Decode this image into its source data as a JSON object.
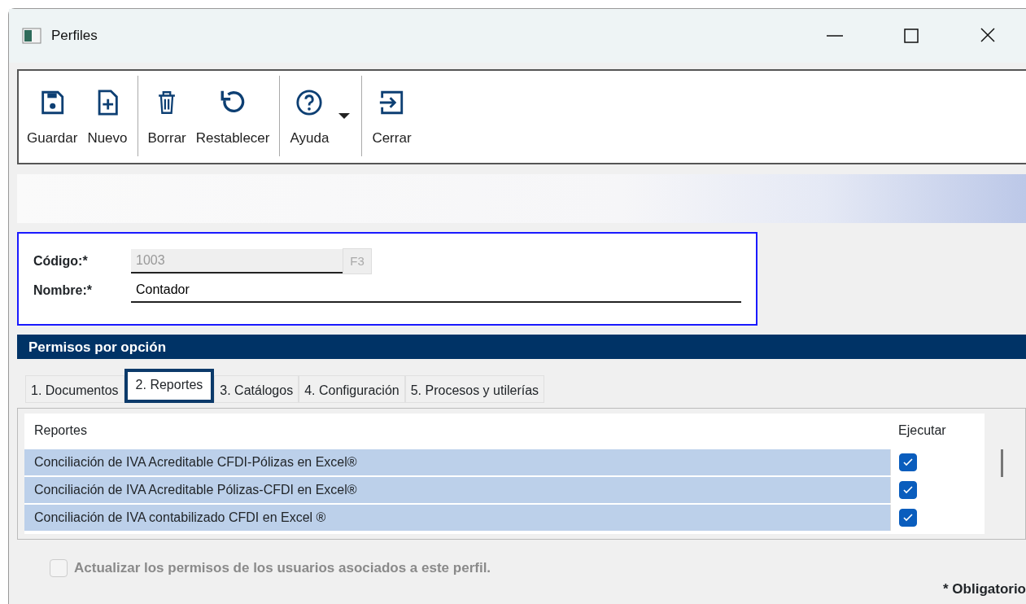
{
  "window": {
    "title": "Perfiles"
  },
  "toolbar": [
    {
      "kind": "save",
      "label": "Guardar",
      "group_end": false,
      "dropdown": false
    },
    {
      "kind": "new",
      "label": "Nuevo",
      "group_end": true,
      "dropdown": false
    },
    {
      "kind": "delete",
      "label": "Borrar",
      "group_end": false,
      "dropdown": false
    },
    {
      "kind": "reset",
      "label": "Restablecer",
      "group_end": true,
      "dropdown": false
    },
    {
      "kind": "help",
      "label": "Ayuda",
      "group_end": true,
      "dropdown": true
    },
    {
      "kind": "close",
      "label": "Cerrar",
      "group_end": false,
      "dropdown": false
    }
  ],
  "form": {
    "fields": [
      {
        "label": "Código:",
        "required_mark": "*",
        "value": "1003",
        "disabled": true,
        "button": "F3"
      },
      {
        "label": "Nombre:",
        "required_mark": "*",
        "value": "Contador",
        "disabled": false
      }
    ]
  },
  "section_title": "Permisos por opción",
  "tabs": [
    {
      "label": "1. Documentos",
      "selected": false
    },
    {
      "label": "2. Reportes",
      "selected": true
    },
    {
      "label": "3. Catálogos",
      "selected": false
    },
    {
      "label": "4. Configuración",
      "selected": false
    },
    {
      "label": "5. Procesos y utilerías",
      "selected": false
    }
  ],
  "table": {
    "columns": [
      "Reportes",
      "Ejecutar"
    ],
    "rows": [
      {
        "name": "Conciliación de IVA Acreditable CFDI-Pólizas en Excel®",
        "checked": true,
        "selected": true
      },
      {
        "name": "Conciliación de IVA Acreditable Pólizas-CFDI en Excel®",
        "checked": true,
        "selected": true
      },
      {
        "name": "Conciliación de IVA contabilizado CFDI en Excel ®",
        "checked": true,
        "selected": true
      }
    ]
  },
  "update_option": {
    "label": "Actualizar los permisos de los usuarios asociados a este perfil.",
    "checked": false,
    "disabled": true
  },
  "footnote": "* Obligatorio"
}
